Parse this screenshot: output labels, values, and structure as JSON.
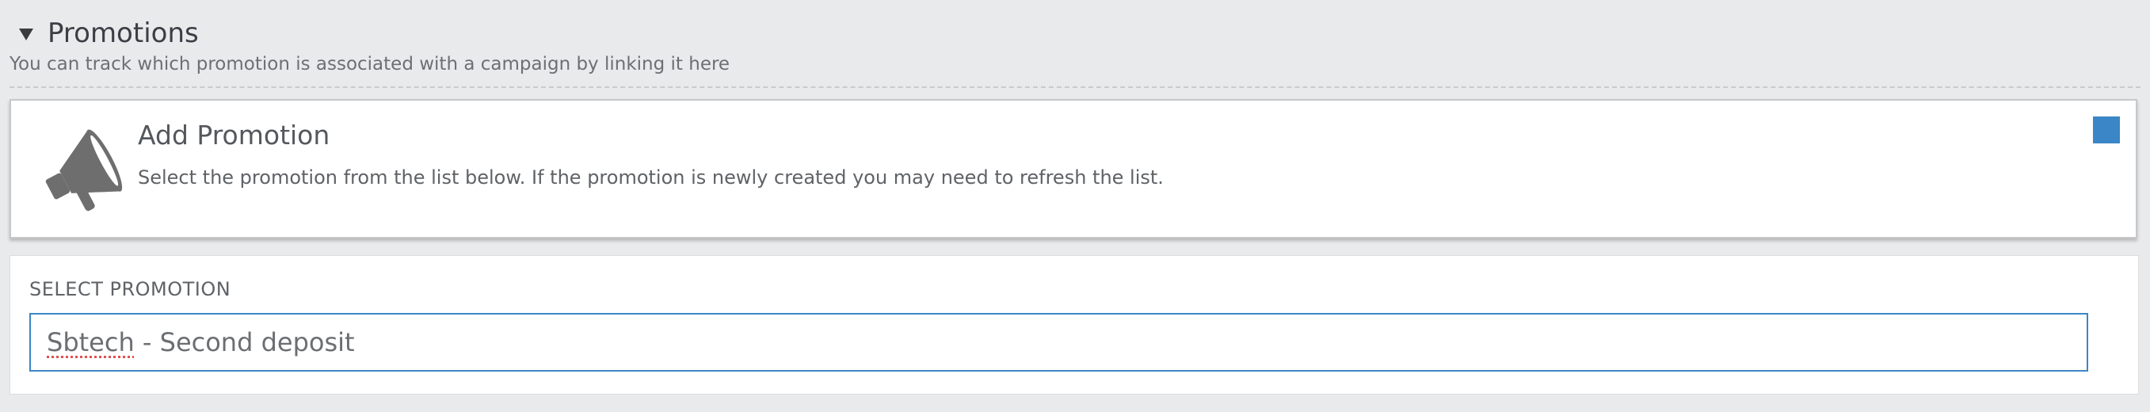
{
  "section": {
    "title": "Promotions",
    "description": "You can track which promotion is associated with a campaign by linking it here"
  },
  "card": {
    "title": "Add Promotion",
    "description": "Select the promotion from the list below. If the promotion is newly created you may need to refresh the list.",
    "icon": "megaphone-icon",
    "toggle_color": "#3b86c6"
  },
  "select": {
    "label": "SELECT PROMOTION",
    "value_part1": "Sbtech",
    "value_part2": " - Second deposit"
  },
  "colors": {
    "accent": "#3b86c6",
    "background": "#e9eaec"
  }
}
